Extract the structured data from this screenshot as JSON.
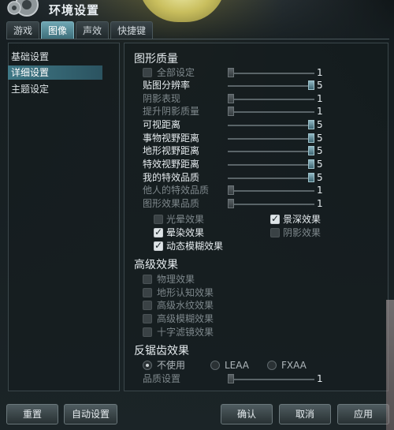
{
  "window": {
    "title": "环境设置"
  },
  "tabs": [
    {
      "label": "游戏"
    },
    {
      "label": "图像"
    },
    {
      "label": "声效"
    },
    {
      "label": "快捷键"
    }
  ],
  "sidebar": {
    "items": [
      {
        "label": "基础设置"
      },
      {
        "label": "详细设置"
      },
      {
        "label": "主题设定"
      }
    ]
  },
  "graphics_quality": {
    "heading": "图形质量",
    "all_settings": {
      "label": "全部设定",
      "value": "1"
    },
    "sliders": [
      {
        "label": "贴图分辨率",
        "value": "5"
      },
      {
        "label": "阴影表现",
        "value": "1"
      },
      {
        "label": "提升阴影质量",
        "value": "1"
      },
      {
        "label": "可视距离",
        "value": "5"
      },
      {
        "label": "事物视野距离",
        "value": "5"
      },
      {
        "label": "地形视野距离",
        "value": "5"
      },
      {
        "label": "特效视野距离",
        "value": "5"
      },
      {
        "label": "我的特效品质",
        "value": "5"
      },
      {
        "label": "他人的特效品质",
        "value": "1"
      },
      {
        "label": "图形效果品质",
        "value": "1"
      }
    ],
    "checkboxes": [
      {
        "label": "光晕效果"
      },
      {
        "label": "景深效果"
      },
      {
        "label": "晕染效果"
      },
      {
        "label": "阴影效果"
      },
      {
        "label": "动态模糊效果"
      }
    ]
  },
  "advanced_effects": {
    "heading": "高级效果",
    "checkboxes": [
      {
        "label": "物理效果"
      },
      {
        "label": "地形认知效果"
      },
      {
        "label": "高级水纹效果"
      },
      {
        "label": "高级模糊效果"
      },
      {
        "label": "十字滤镜效果"
      }
    ]
  },
  "antialiasing": {
    "heading": "反锯齿效果",
    "options": [
      {
        "label": "不使用"
      },
      {
        "label": "LEAA"
      },
      {
        "label": "FXAA"
      }
    ],
    "quality": {
      "label": "品质设置",
      "value": "1"
    }
  },
  "buttons": {
    "reset": "重置",
    "auto": "自动设置",
    "confirm": "确认",
    "cancel": "取消",
    "apply": "应用"
  },
  "colors": {
    "accent": "#3f7886",
    "background": "#1b2427"
  }
}
